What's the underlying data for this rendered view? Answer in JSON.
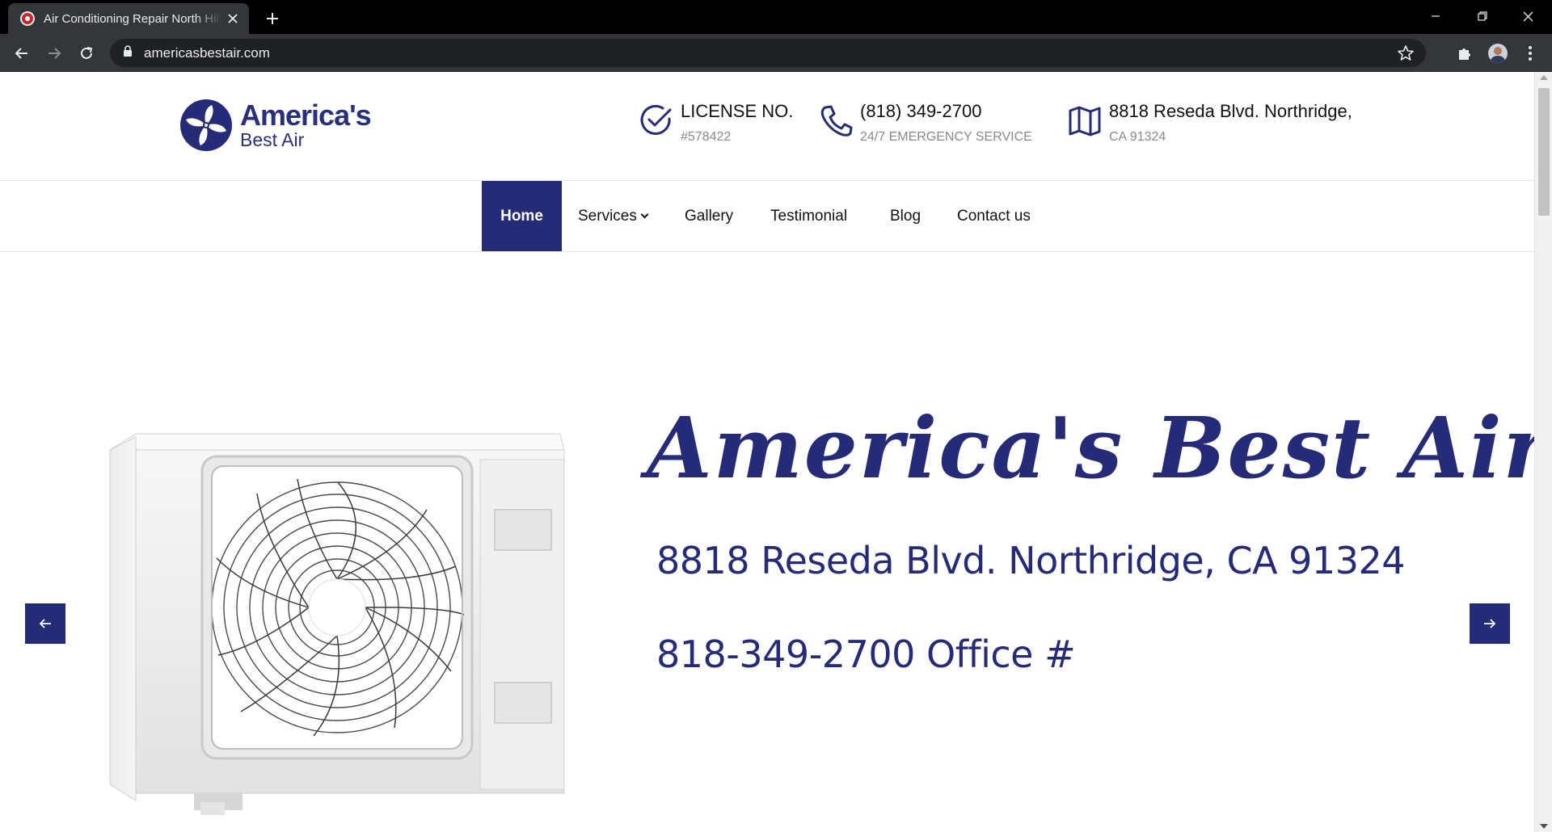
{
  "browser": {
    "tab_title": "Air Conditioning Repair North Hills",
    "url": "americasbestair.com"
  },
  "header": {
    "logo": {
      "line1": "America's",
      "line2": "Best Air"
    },
    "license": {
      "title": "LICENSE NO.",
      "sub": "#578422"
    },
    "phone": {
      "title": "(818) 349-2700",
      "sub": "24/7 EMERGENCY SERVICE"
    },
    "address": {
      "title": "8818 Reseda Blvd. Northridge,",
      "sub": "CA 91324"
    }
  },
  "nav": {
    "items": [
      {
        "label": "Home",
        "active": true
      },
      {
        "label": "Services",
        "dropdown": true
      },
      {
        "label": "Gallery"
      },
      {
        "label": "Testimonial"
      },
      {
        "label": "Blog"
      },
      {
        "label": "Contact us"
      }
    ]
  },
  "hero": {
    "title": "America's Best Air",
    "address": "8818 Reseda Blvd. Northridge, CA 91324",
    "phone": "818-349-2700 Office #"
  },
  "colors": {
    "brand": "#262b78",
    "tabbar": "#000000",
    "toolbar": "#35363a"
  },
  "icons": {
    "license": "check-circle-icon",
    "phone": "phone-icon",
    "address": "map-icon",
    "prev": "arrow-left-icon",
    "next": "arrow-right-icon"
  }
}
